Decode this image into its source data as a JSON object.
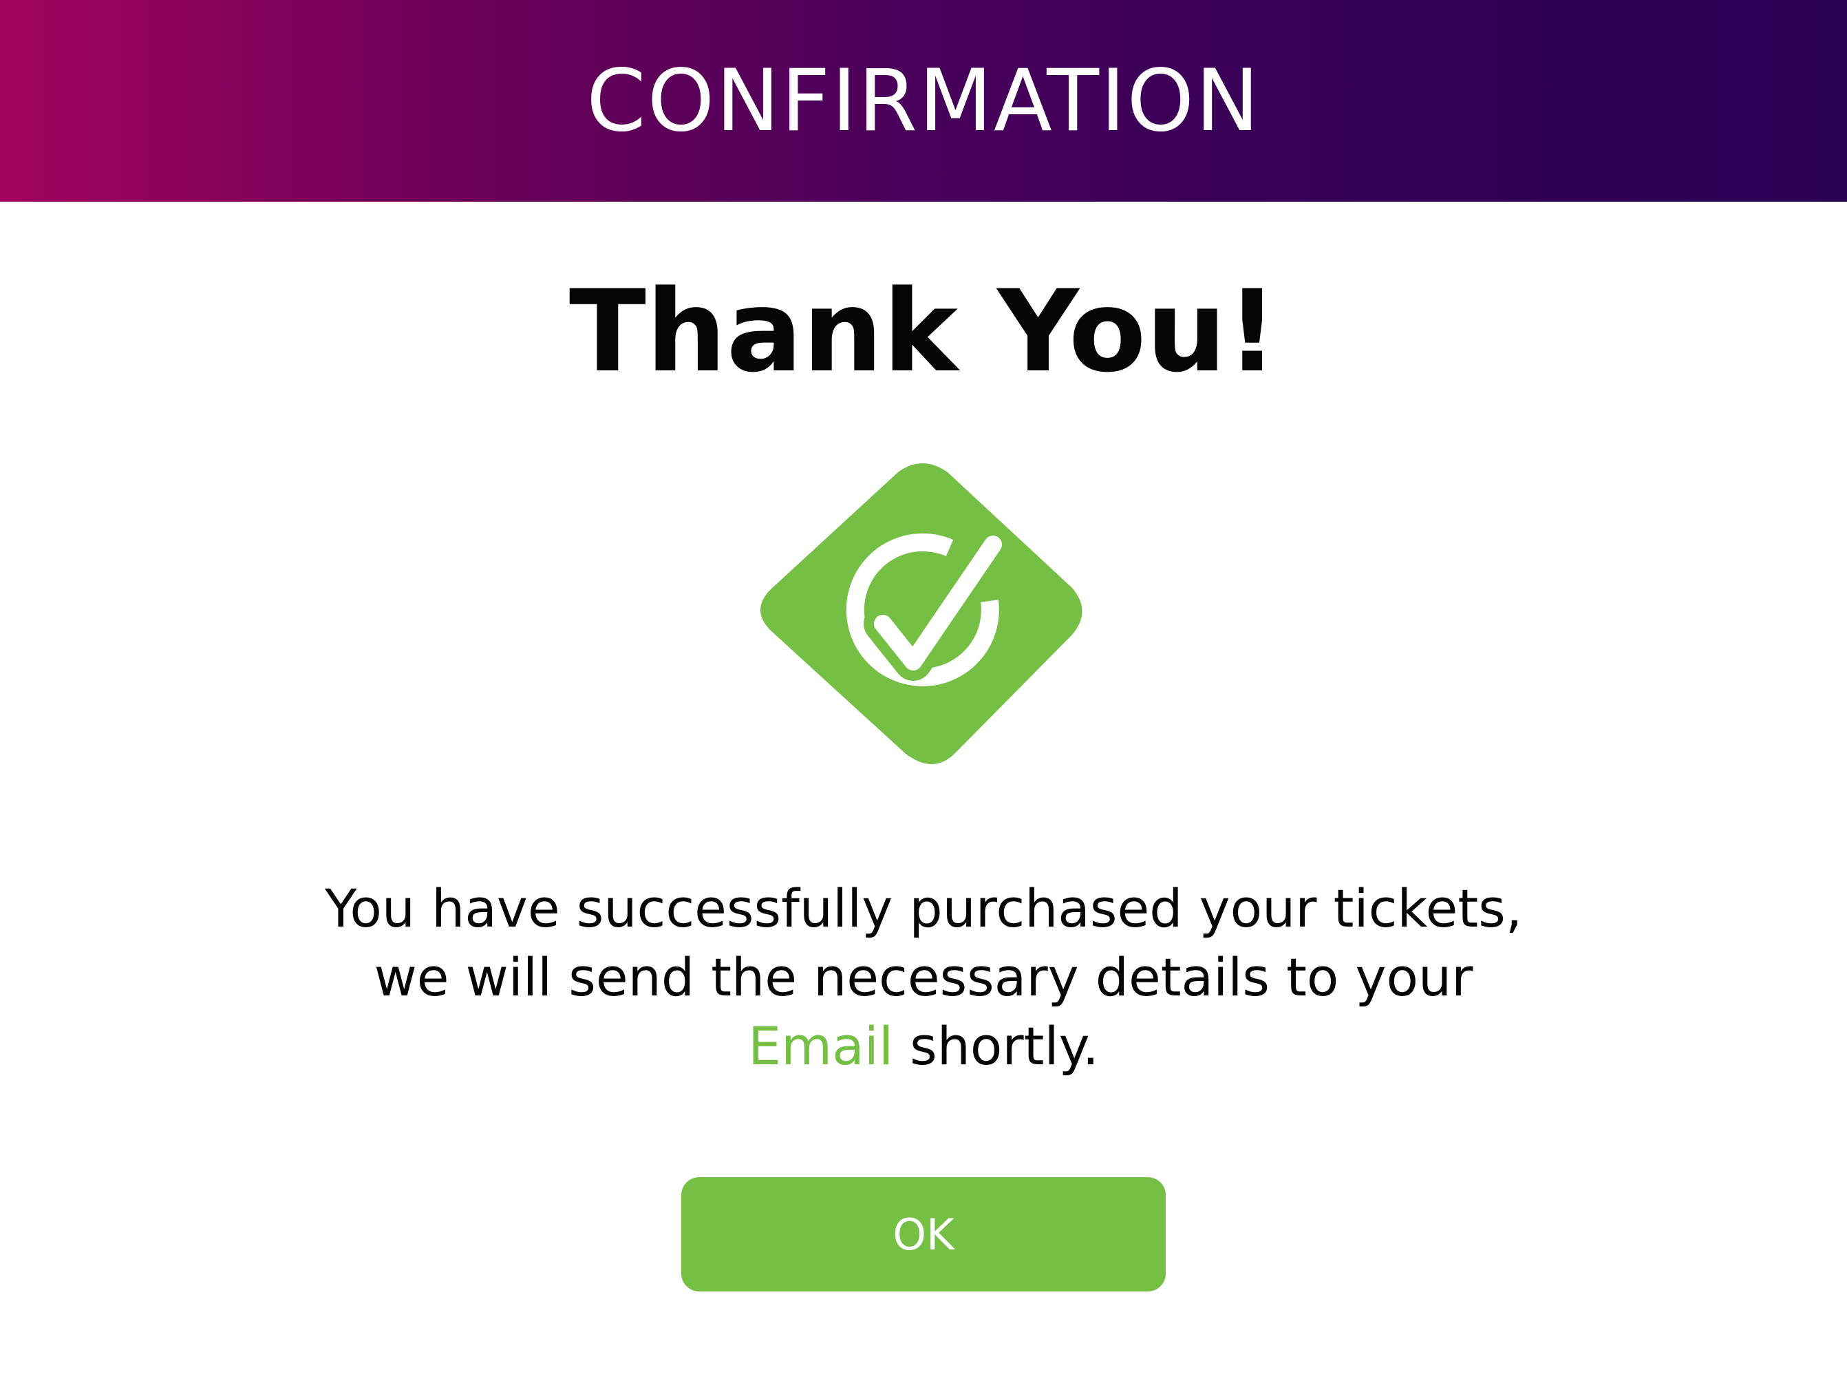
{
  "header": {
    "title": "CONFIRMATION"
  },
  "main": {
    "heading": "Thank You!",
    "message_part1": "You have successfully purchased your tickets, we will send the necessary details to your ",
    "message_highlight": "Email",
    "message_part2": " shortly.",
    "icon": "check-circle-diamond-icon"
  },
  "actions": {
    "ok_label": "OK"
  },
  "colors": {
    "accent_green": "#76bf45",
    "header_gradient_start": "#a1045f",
    "header_gradient_end": "#2a0055"
  }
}
